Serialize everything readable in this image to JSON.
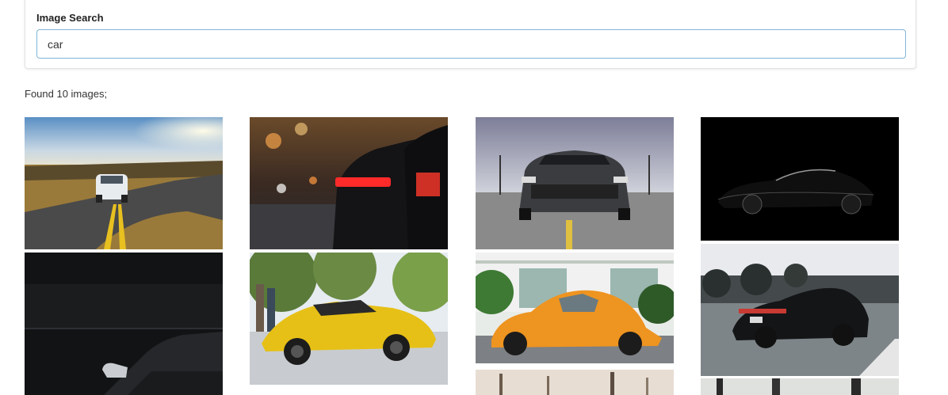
{
  "search": {
    "label": "Image Search",
    "value": "car"
  },
  "results": {
    "summary": "Found 10 images;"
  },
  "images": [
    {
      "subject": "white sports car on a winding road at sunset"
    },
    {
      "subject": "black sports car rear lights on a city street"
    },
    {
      "subject": "front of a dark grey Mustang on an empty lot"
    },
    {
      "subject": "black sedan silhouette on black background"
    },
    {
      "subject": "dark car interior with side mirror"
    },
    {
      "subject": "yellow Lamborghini with trees behind"
    },
    {
      "subject": "orange Volkswagen Beetle in front of a building"
    },
    {
      "subject": "black Porsche Panamera driving on a highway"
    },
    {
      "subject": "trees, partially visible image"
    },
    {
      "subject": "palm trees, partially visible image"
    }
  ]
}
